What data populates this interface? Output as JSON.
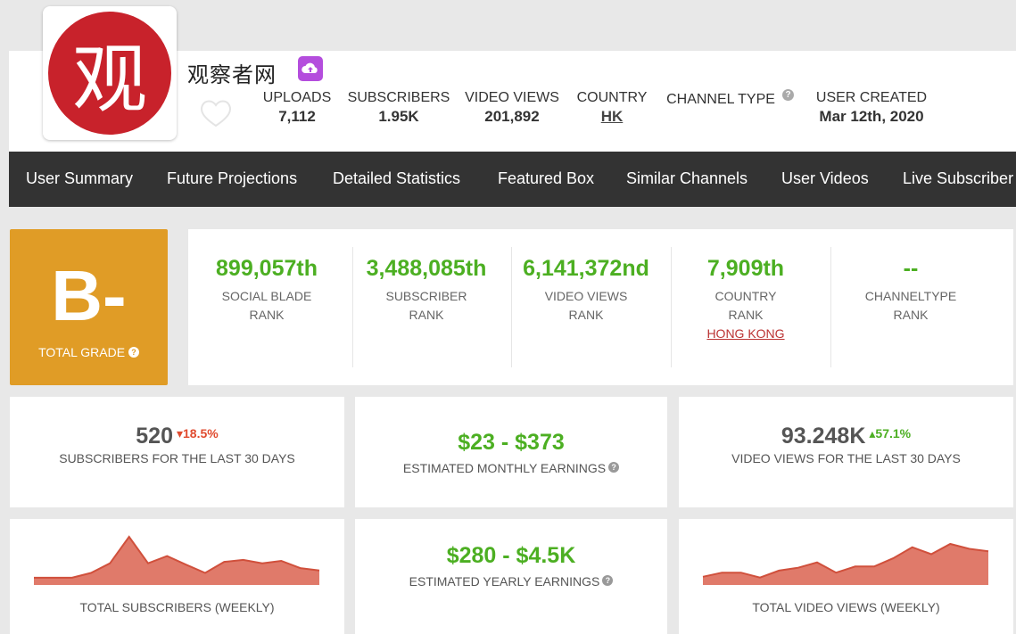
{
  "header": {
    "channel_name": "观察者网",
    "avatar_char": "观",
    "stats": [
      {
        "label": "UPLOADS",
        "value": "7,112"
      },
      {
        "label": "SUBSCRIBERS",
        "value": "1.95K"
      },
      {
        "label": "VIDEO VIEWS",
        "value": "201,892"
      },
      {
        "label": "COUNTRY",
        "value": "HK"
      },
      {
        "label": "CHANNEL TYPE",
        "value": ""
      },
      {
        "label": "USER CREATED",
        "value": "Mar 12th, 2020"
      }
    ],
    "help_glyph": "?"
  },
  "nav": [
    "User Summary",
    "Future Projections",
    "Detailed Statistics",
    "Featured Box",
    "Similar Channels",
    "User Videos",
    "Live Subscriber"
  ],
  "grade": {
    "letter": "B-",
    "label": "TOTAL GRADE",
    "help": "?",
    "color": "#e09c26"
  },
  "ranks": [
    {
      "num": "899,057th",
      "l1": "SOCIAL BLADE",
      "l2": "RANK"
    },
    {
      "num": "3,488,085th",
      "l1": "SUBSCRIBER",
      "l2": "RANK"
    },
    {
      "num": "6,141,372nd",
      "l1": "VIDEO VIEWS",
      "l2": "RANK"
    },
    {
      "num": "7,909th",
      "l1": "COUNTRY",
      "l2": "RANK",
      "link": "HONG KONG"
    },
    {
      "num": "--",
      "l1": "CHANNELTYPE",
      "l2": "RANK"
    }
  ],
  "cards": {
    "subs30": {
      "value": "520",
      "pct": "18.5%",
      "label": "SUBSCRIBERS FOR THE LAST 30 DAYS"
    },
    "monthly": {
      "value": "$23 - $373",
      "label": "ESTIMATED MONTHLY EARNINGS"
    },
    "views30": {
      "value": "93.248K",
      "pct": "57.1%",
      "label": "VIDEO VIEWS FOR THE LAST 30 DAYS"
    },
    "yearly": {
      "value": "$280 - $4.5K",
      "label": "ESTIMATED YEARLY EARNINGS"
    },
    "subs_weekly": {
      "label": "TOTAL SUBSCRIBERS (WEEKLY)"
    },
    "views_weekly": {
      "label": "TOTAL VIDEO VIEWS (WEEKLY)"
    }
  },
  "colors": {
    "accent_green": "#4caf22",
    "down_red": "#e04b2f",
    "spark_fill": "#e07a6a",
    "spark_stroke": "#d0503c",
    "nav_bg": "#333333"
  },
  "chart_data": [
    {
      "type": "area",
      "title": "TOTAL SUBSCRIBERS (WEEKLY)",
      "series": [
        {
          "values": [
            0.15,
            0.15,
            0.15,
            0.25,
            0.45,
            1.0,
            0.45,
            0.6,
            0.42,
            0.25,
            0.48,
            0.52,
            0.45,
            0.5,
            0.35,
            0.3
          ]
        }
      ]
    },
    {
      "type": "area",
      "title": "TOTAL VIDEO VIEWS (WEEKLY)",
      "series": [
        {
          "values": [
            0.2,
            0.3,
            0.3,
            0.18,
            0.35,
            0.42,
            0.55,
            0.3,
            0.45,
            0.45,
            0.65,
            0.92,
            0.75,
            1.0,
            0.88,
            0.82
          ]
        }
      ]
    }
  ]
}
